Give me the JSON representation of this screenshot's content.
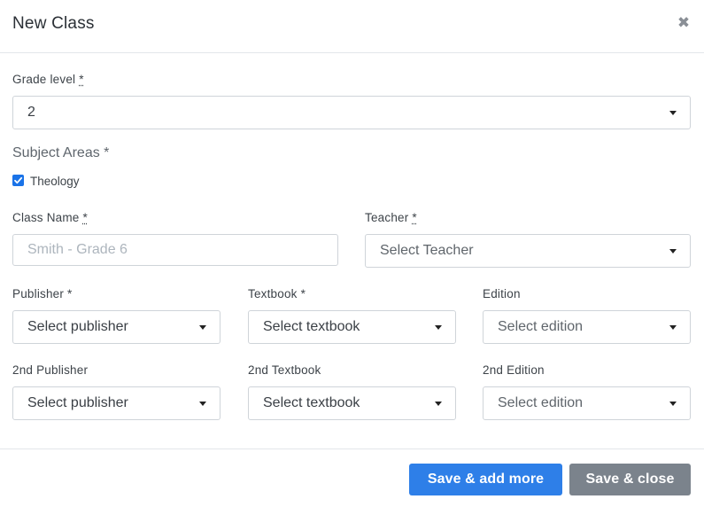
{
  "modal": {
    "title": "New Class",
    "close_glyph": "✖"
  },
  "grade_level": {
    "label": "Grade level",
    "required_mark": "*",
    "value": "2"
  },
  "subject_areas": {
    "label": "Subject Areas *",
    "options": [
      {
        "label": "Theology",
        "checked": true
      }
    ]
  },
  "class_name": {
    "label": "Class Name",
    "required_mark": "*",
    "placeholder": "Smith - Grade 6",
    "value": ""
  },
  "teacher": {
    "label": "Teacher",
    "required_mark": "*",
    "value": "Select Teacher"
  },
  "publisher": {
    "label": "Publisher *",
    "value": "Select publisher"
  },
  "textbook": {
    "label": "Textbook *",
    "value": "Select textbook"
  },
  "edition": {
    "label": "Edition",
    "value": "Select edition"
  },
  "publisher2": {
    "label": "2nd Publisher",
    "value": "Select publisher"
  },
  "textbook2": {
    "label": "2nd Textbook",
    "value": "Select textbook"
  },
  "edition2": {
    "label": "2nd Edition",
    "value": "Select edition"
  },
  "footer": {
    "save_add_more": "Save & add more",
    "save_close": "Save & close"
  },
  "colors": {
    "primary": "#2e7fe8",
    "secondary": "#7b838c",
    "checkbox": "#1a73e8"
  },
  "icons": {
    "close": "close-icon",
    "dropdown": "caret-down-icon",
    "check": "check-icon"
  }
}
